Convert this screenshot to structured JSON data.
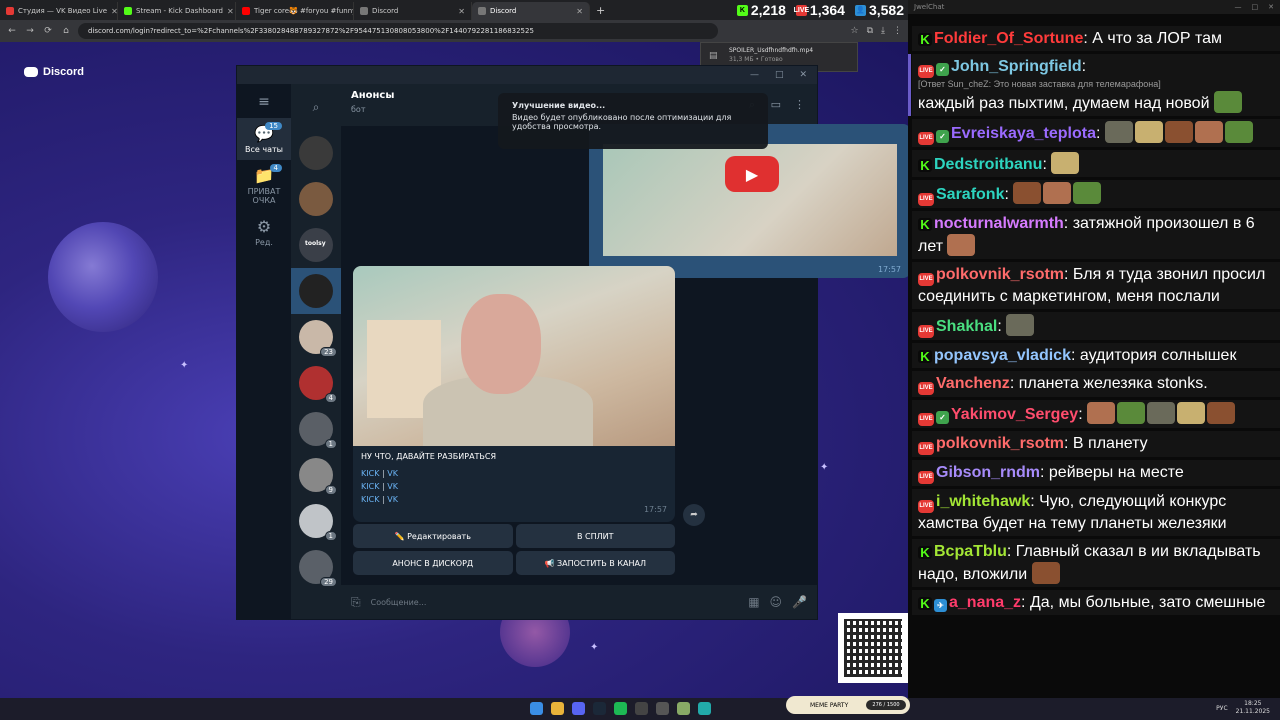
{
  "browser": {
    "tabs": [
      {
        "label": "Студия — VK Видео Live",
        "color": "#e53935",
        "active": false
      },
      {
        "label": "Stream - Kick Dashboard",
        "color": "#53fc18",
        "active": false
      },
      {
        "label": "Tiger core🐯 #foryou #funny",
        "color": "#ff0000",
        "active": false
      },
      {
        "label": "Discord",
        "color": "#777777",
        "active": false
      },
      {
        "label": "Discord",
        "color": "#777777",
        "active": true
      }
    ],
    "url": "discord.com/login?redirect_to=%2Fchannels%2F338028488789327872%2F954475130808053800%2F1440792281186832525",
    "stats": {
      "kick": "2,218",
      "live": "1,364",
      "viewers": "3,582"
    },
    "download": {
      "filename": "SPOILER_Usdfhndfhdfh.mp4",
      "size": "31,3 МБ • Готово"
    }
  },
  "discord": {
    "logo": "Discord"
  },
  "telegram": {
    "folders": [
      {
        "label": "Все чаты",
        "count": "15",
        "active": true
      },
      {
        "label": "ПРИВАТ ОЧКА",
        "count": "4",
        "active": false
      },
      {
        "label": "Ред.",
        "count": "",
        "active": false
      }
    ],
    "chat_badges": [
      "23",
      "4",
      "1",
      "9",
      "1",
      "29"
    ],
    "chat_toolsy": "toolsy",
    "header": {
      "name": "Анонсы",
      "subtitle": "бот"
    },
    "tooltip": {
      "title": "Улучшение видео...",
      "body": "Видео будет опубликовано после оптимизации для удобства просмотра."
    },
    "msg_top_time": "17:57",
    "message": {
      "text": "НУ ЧТО, ДАВАЙТЕ РАЗБИРАТЬСЯ",
      "links": [
        [
          "KICK",
          "VK"
        ],
        [
          "KICK",
          "VK"
        ],
        [
          "KICK",
          "VK"
        ]
      ],
      "separator": "|",
      "time": "17:57"
    },
    "buttons": [
      "✏️ Редактировать",
      "В СПЛИТ",
      "АНОНС В ДИСКОРД",
      "📢 ЗАПОСТИТЬ В КАНАЛ"
    ],
    "input_placeholder": "Сообщение..."
  },
  "chat": {
    "title": "JwelChat",
    "messages": [
      {
        "platform": "kick",
        "name": "Foldier_Of_Sortune",
        "color": "#ff3b3b",
        "text": "А что за ЛОР там",
        "emotes": 0
      },
      {
        "platform": "live",
        "extra": "mod",
        "name": "John_Springfield",
        "color": "#7ec8e3",
        "reply": "[Ответ Sun_cheZ: Это новая заставка для телемарафона]",
        "text": "каждый раз пыхтим, думаем над новой",
        "emotes": 1,
        "accent": true
      },
      {
        "platform": "live",
        "extra": "mod",
        "name": "Evreiskaya_teplota",
        "color": "#9b6bff",
        "text": "",
        "emotes": 5
      },
      {
        "platform": "kick",
        "name": "Dedstroitbanu",
        "color": "#2dd4bf",
        "text": "",
        "emotes": 1
      },
      {
        "platform": "live",
        "name": "Sarafonk",
        "color": "#2dd4bf",
        "text": "",
        "emotes": 3
      },
      {
        "platform": "kick",
        "name": "nocturnalwarmth",
        "color": "#d67bff",
        "text": "затяжной произошел в 6 лет",
        "emotes": 1
      },
      {
        "platform": "live",
        "name": "polkovnik_rsotm",
        "color": "#ff6b6b",
        "text": "Бля я туда звонил просил соединить с маркетингом, меня послали",
        "emotes": 0
      },
      {
        "platform": "live",
        "name": "Shakhal",
        "color": "#4ade80",
        "text": "",
        "emotes": 1
      },
      {
        "platform": "kick",
        "name": "popavsya_vladick",
        "color": "#93c5fd",
        "text": "аудитория солнышек",
        "emotes": 0
      },
      {
        "platform": "live",
        "name": "Vanchenz",
        "color": "#ff6b6b",
        "text": "планета железяка stonks.",
        "emotes": 0
      },
      {
        "platform": "live",
        "extra": "mod",
        "name": "Yakimov_Sergey",
        "color": "#ff4d6d",
        "text": "",
        "emotes": 5
      },
      {
        "platform": "live",
        "name": "polkovnik_rsotm",
        "color": "#ff6b6b",
        "text": "В планету",
        "emotes": 0
      },
      {
        "platform": "live",
        "name": "Gibson_rndm",
        "color": "#a78bfa",
        "text": "рейверы на месте",
        "emotes": 0
      },
      {
        "platform": "live",
        "name": "i_whitehawk",
        "color": "#a3e635",
        "text": "Чую, следующий конкурс хамства будет на тему планеты железяки",
        "emotes": 0
      },
      {
        "platform": "kick",
        "name": "BcpaTblu",
        "color": "#a3e635",
        "text": "Главный сказал в ии вкладывать надо, вложили",
        "emotes": 1
      },
      {
        "platform": "kick",
        "extra": "vip",
        "name": "a_nana_z",
        "color": "#ff3b6b",
        "text": "Да, мы больные, зато смешные",
        "emotes": 0
      }
    ]
  },
  "taskbar": {
    "lang": "РУС",
    "time": "18:25",
    "date": "21.11.2025",
    "meme_label": "MEME PARTY",
    "meme_count": "276 / 1500"
  }
}
